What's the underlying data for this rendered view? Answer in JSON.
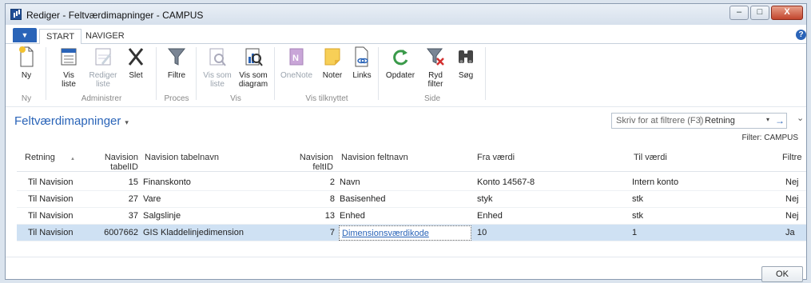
{
  "window": {
    "title": "Rediger - Feltværdimapninger - CAMPUS",
    "controls": {
      "minimize": "–",
      "maximize": "□",
      "close": "X"
    }
  },
  "tabs": {
    "file_glyph": "▼",
    "start": "START",
    "navigate": "NAVIGER",
    "help": "?"
  },
  "ribbon": {
    "groups": [
      {
        "label": "Ny",
        "buttons": [
          {
            "label": "Ny",
            "icon": "new-document-icon"
          }
        ]
      },
      {
        "label": "Administrer",
        "buttons": [
          {
            "label": "Vis\nliste",
            "icon": "view-list-icon"
          },
          {
            "label": "Rediger\nliste",
            "icon": "edit-list-icon",
            "disabled": true
          },
          {
            "label": "Slet",
            "icon": "delete-x-icon"
          }
        ]
      },
      {
        "label": "Proces",
        "buttons": [
          {
            "label": "Filtre",
            "icon": "filter-funnel-icon"
          }
        ]
      },
      {
        "label": "Vis",
        "buttons": [
          {
            "label": "Vis som\nliste",
            "icon": "view-as-list-icon",
            "disabled": true
          },
          {
            "label": "Vis som\ndiagram",
            "icon": "view-as-chart-icon"
          }
        ]
      },
      {
        "label": "Vis tilknyttet",
        "buttons": [
          {
            "label": "OneNote",
            "icon": "onenote-icon",
            "disabled": true
          },
          {
            "label": "Noter",
            "icon": "note-icon"
          },
          {
            "label": "Links",
            "icon": "links-icon"
          }
        ]
      },
      {
        "label": "Side",
        "buttons": [
          {
            "label": "Opdater",
            "icon": "refresh-icon"
          },
          {
            "label": "Ryd\nfilter",
            "icon": "clear-filter-icon"
          },
          {
            "label": "Søg",
            "icon": "binoculars-icon"
          }
        ]
      }
    ]
  },
  "page": {
    "title": "Feltværdimapninger",
    "caret": "▾",
    "search_placeholder": "Skriv for at filtrere (F3)",
    "search_field": "Retning",
    "search_dropdown": "▾",
    "search_go": "→",
    "collapse": "⌄",
    "filter_label": "Filter: CAMPUS"
  },
  "grid": {
    "sort_glyph": "▲",
    "headers": {
      "direction": "Retning",
      "table_id": "Navision\ntabelID",
      "table_name": "Navision tabelnavn",
      "field_id": "Navision\nfeltID",
      "field_name": "Navision feltnavn",
      "from_value": "Fra værdi",
      "to_value": "Til værdi",
      "filters": "Filtre"
    },
    "rows": [
      {
        "direction": "Til Navision",
        "table_id": "15",
        "table_name": "Finanskonto",
        "field_id": "2",
        "field_name": "Navn",
        "from_value": "Konto 14567-8",
        "to_value": "Intern konto",
        "filters": "Nej"
      },
      {
        "direction": "Til Navision",
        "table_id": "27",
        "table_name": "Vare",
        "field_id": "8",
        "field_name": "Basisenhed",
        "from_value": "styk",
        "to_value": "stk",
        "filters": "Nej"
      },
      {
        "direction": "Til Navision",
        "table_id": "37",
        "table_name": "Salgslinje",
        "field_id": "13",
        "field_name": "Enhed",
        "from_value": "Enhed",
        "to_value": "stk",
        "filters": "Nej"
      },
      {
        "direction": "Til Navision",
        "table_id": "6007662",
        "table_name": "GIS Kladdelinjedimension",
        "field_id": "7",
        "field_name": "Dimensionsværdikode",
        "from_value": "10",
        "to_value": "1",
        "filters": "Ja"
      }
    ]
  },
  "footer": {
    "ok_label": "OK"
  },
  "colors": {
    "accent": "#2a64b8",
    "selected_row": "#cfe1f3"
  }
}
